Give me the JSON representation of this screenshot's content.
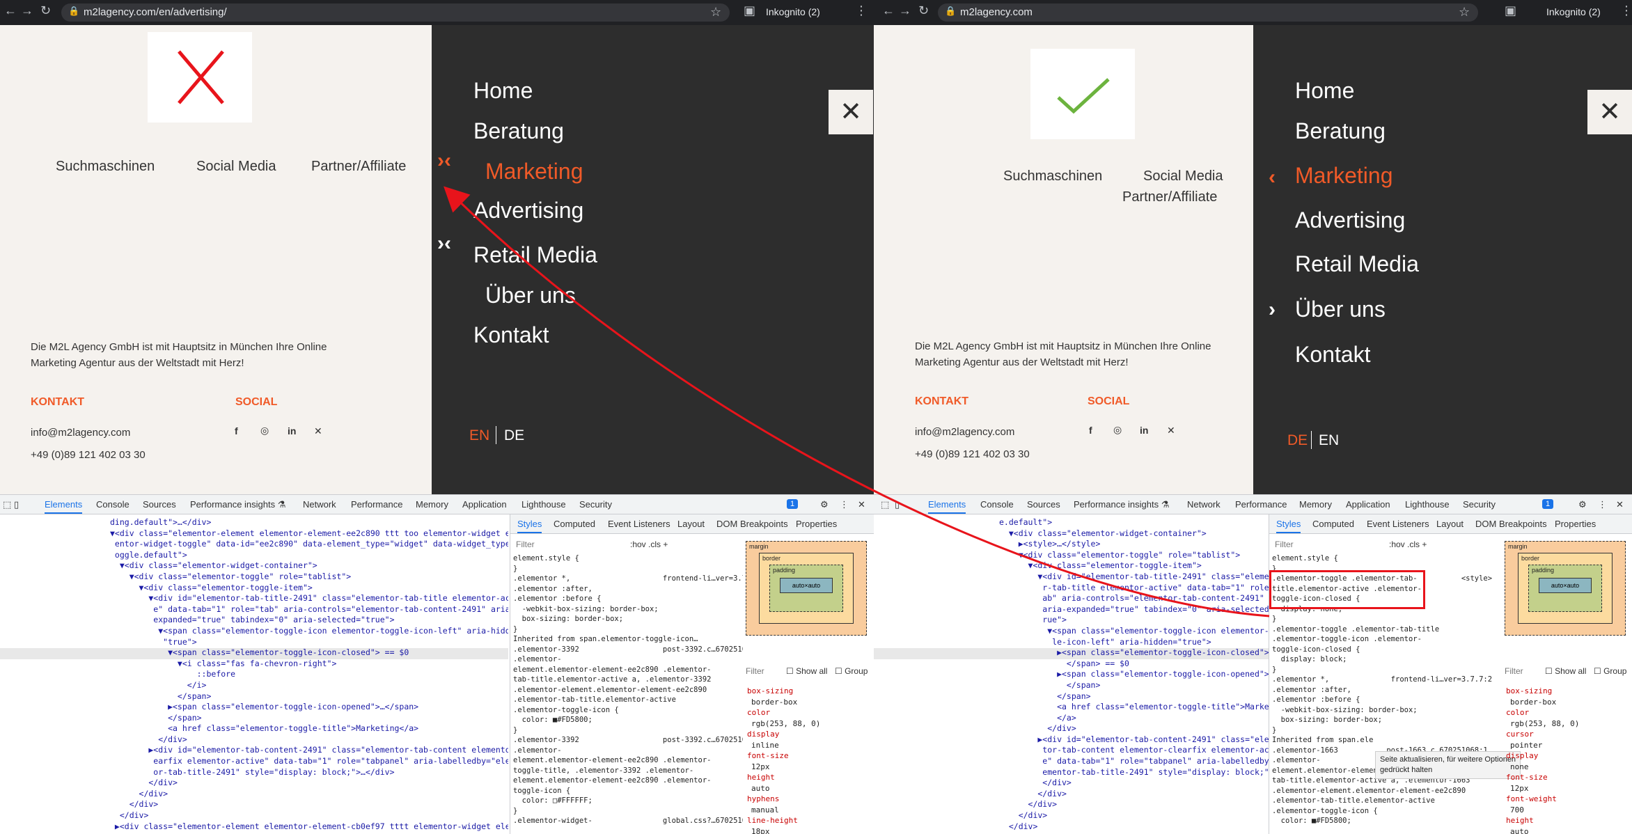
{
  "left": {
    "browser": {
      "url": "m2lagency.com/en/advertising/",
      "profile": "Inkognito (2)"
    },
    "nav": [
      "Home",
      "Beratung",
      "Marketing",
      "Advertising",
      "Retail Media",
      "Über uns",
      "Kontakt"
    ],
    "active": "Marketing",
    "categories": [
      "Suchmaschinen",
      "Social Media",
      "Partner/Affiliate"
    ],
    "intro": [
      "Die M2L Agency GmbH ist mit Hauptsitz in München Ihre Online",
      "Marketing Agentur aus der Weltstadt mit Herz!"
    ],
    "kontakt_h": "KONTAKT",
    "social_h": "SOCIAL",
    "email": "info@m2lagency.com",
    "phone": "+49 (0)89 121 402 03 30",
    "lang_active": "EN",
    "lang_other": "DE",
    "code": [
      "ding.default\">…</div>",
      "▼<div class=\"elementor-element elementor-element-ee2c890 ttt too elementor-widget elem",
      " entor-widget-toggle\" data-id=\"ee2c890\" data-element_type=\"widget\" data-widget_type=\"t",
      " oggle.default\">",
      "  ▼<div class=\"elementor-widget-container\">",
      "    ▼<div class=\"elementor-toggle\" role=\"tablist\">",
      "      ▼<div class=\"elementor-toggle-item\">",
      "        ▼<div id=\"elementor-tab-title-2491\" class=\"elementor-tab-title elementor-activ",
      "         e\" data-tab=\"1\" role=\"tab\" aria-controls=\"elementor-tab-content-2491\" aria-",
      "         expanded=\"true\" tabindex=\"0\" aria-selected=\"true\">",
      "          ▼<span class=\"elementor-toggle-icon elementor-toggle-icon-left\" aria-hidden=",
      "           \"true\">",
      "            ▼<span class=\"elementor-toggle-icon-closed\"> == $0",
      "              ▼<i class=\"fas fa-chevron-right\">",
      "                  ::before",
      "                </i>",
      "              </span>",
      "            ▶<span class=\"elementor-toggle-icon-opened\">…</span>",
      "            </span>",
      "            <a href class=\"elementor-toggle-title\">Marketing</a>",
      "          </div>",
      "        ▶<div id=\"elementor-tab-content-2491\" class=\"elementor-tab-content elementor-cl",
      "         earfix elementor-active\" data-tab=\"1\" role=\"tabpanel\" aria-labelledby=\"element",
      "         or-tab-title-2491\" style=\"display: block;\">…</div>",
      "        </div>",
      "      </div>",
      "    </div>",
      "  </div>",
      " ▶<div class=\"elementor-element elementor-element-cb0ef97 tttt elementor-widget elem"
    ],
    "styles": [
      "element.style {",
      "}",
      ".elementor *,                     frontend-li…ver=3.7.7:2",
      ".elementor :after,",
      ".elementor :before {",
      "  -webkit-box-sizing: border-box;",
      "  box-sizing: border-box;",
      "}",
      "Inherited from span.elementor-toggle-icon…",
      ".elementor-3392                   post-3392.c…670251071:1",
      ".elementor-",
      "element.elementor-element-ee2c890 .elementor-",
      "tab-title.elementor-active a, .elementor-3392",
      ".elementor-element.elementor-element-ee2c890",
      ".elementor-tab-title.elementor-active",
      ".elementor-toggle-icon {",
      "  color: ■#FD5800;",
      "}",
      ".elementor-3392                   post-3392.c…670251071:1",
      ".elementor-",
      "element.elementor-element-ee2c890 .elementor-",
      "toggle-title, .elementor-3392 .elementor-",
      "element.elementor-element-ee2c890 .elementor-",
      "toggle-icon {",
      "  color: □#FFFFFF;",
      "}",
      ".elementor-widget-                global.css?…670251069:2"
    ],
    "computed": [
      "box-sizing",
      "border-box",
      "color",
      "rgb(253, 88, 0)",
      "display",
      "inline",
      "font-size",
      "12px",
      "height",
      "auto",
      "hyphens",
      "manual",
      "line-height",
      "18px"
    ]
  },
  "right": {
    "browser": {
      "url": "m2lagency.com",
      "profile": "Inkognito (2)"
    },
    "nav": [
      "Home",
      "Beratung",
      "Marketing",
      "Advertising",
      "Retail Media",
      "Über uns",
      "Kontakt"
    ],
    "active": "Marketing",
    "categories": [
      "Suchmaschinen",
      "Social Media",
      "Partner/Affiliate"
    ],
    "intro": [
      "Die M2L Agency GmbH ist mit Hauptsitz in München Ihre Online",
      "Marketing Agentur aus der Weltstadt mit Herz!"
    ],
    "kontakt_h": "KONTAKT",
    "social_h": "SOCIAL",
    "email": "info@m2lagency.com",
    "phone": "+49 (0)89 121 402 03 30",
    "lang_active": "DE",
    "lang_other": "EN",
    "code": [
      "e.default\">",
      "  ▼<div class=\"elementor-widget-container\">",
      "    ▶<style>…</style>",
      "    ▼<div class=\"elementor-toggle\" role=\"tablist\">",
      "      ▼<div class=\"elementor-toggle-item\">",
      "        ▼<div id=\"elementor-tab-title-2491\" class=\"elemento",
      "         r-tab-title elementor-active\" data-tab=\"1\" role=\"t",
      "         ab\" aria-controls=\"elementor-tab-content-2491\"",
      "         aria-expanded=\"true\" tabindex=\"0\" aria-selected=\"t",
      "         rue\">",
      "          ▼<span class=\"elementor-toggle-icon elementor-togg",
      "           le-icon-left\" aria-hidden=\"true\">",
      "            ▶<span class=\"elementor-toggle-icon-closed\">…",
      "              </span> == $0",
      "            ▶<span class=\"elementor-toggle-icon-opened\">…",
      "              </span>",
      "            </span>",
      "            <a href class=\"elementor-toggle-title\">Marketing",
      "            </a>",
      "          </div>",
      "        ▶<div id=\"elementor-tab-content-2491\" class=\"elemen",
      "         tor-tab-content elementor-clearfix elementor-activ",
      "         e\" data-tab=\"1\" role=\"tabpanel\" aria-labelledby=\"el",
      "         ementor-tab-title-2491\" style=\"display: block;\">…",
      "         </div>",
      "        </div>",
      "      </div>",
      "    </div>",
      "  </div>"
    ],
    "styles": [
      "element.style {",
      "}",
      ".elementor-toggle .elementor-tab-          <style>",
      "title.elementor-active .elementor-",
      "toggle-icon-closed {",
      "  display: none;",
      "}",
      ".elementor-toggle .elementor-tab-title",
      ".elementor-toggle-icon .elementor-",
      "toggle-icon-closed {",
      "  display: block;",
      "}",
      ".elementor *,              frontend-li…ver=3.7.7:2",
      ".elementor :after,",
      ".elementor :before {",
      "  -webkit-box-sizing: border-box;",
      "  box-sizing: border-box;",
      "}",
      "Inherited from span.ele",
      ".elementor-1663           post-1663.c…670251068:1",
      ".elementor-",
      "element.elementor-element-ee2c890 .elementor-",
      "tab-title.elementor-active a, .elementor-1663",
      ".elementor-element.elementor-element-ee2c890",
      ".elementor-tab-title.elementor-active",
      ".elementor-toggle-icon {",
      "  color: ■#FD5800;"
    ],
    "computed": [
      "box-sizing",
      "border-box",
      "color",
      "rgb(253, 88, 0)",
      "cursor",
      "pointer",
      "display",
      "none",
      "font-size",
      "12px",
      "font-weight",
      "700",
      "height",
      "auto"
    ],
    "tooltip": [
      "Seite aktualisieren, für weitere Optionen",
      "gedrückt halten"
    ]
  },
  "devtools": {
    "tabs": [
      "Elements",
      "Console",
      "Sources",
      "Performance insights ⚗",
      "Network",
      "Performance",
      "Memory",
      "Application",
      "Lighthouse",
      "Security"
    ],
    "styles_tabs": [
      "Styles",
      "Computed",
      "Event Listeners",
      "Layout",
      "DOM Breakpoints",
      "Properties"
    ],
    "filter": "Filter",
    "hov": ":hov .cls +",
    "show_all": "Show all",
    "group": "Group",
    "box": {
      "margin": "margin",
      "border": "border",
      "padding": "padding",
      "content": "auto×auto",
      "dash": "-"
    },
    "badge": "1"
  },
  "colors": {
    "accent": "#f05a28",
    "menu_bg": "#2d2d2d",
    "site_bg": "#f5f2ee",
    "annotation": "#e8141b"
  }
}
